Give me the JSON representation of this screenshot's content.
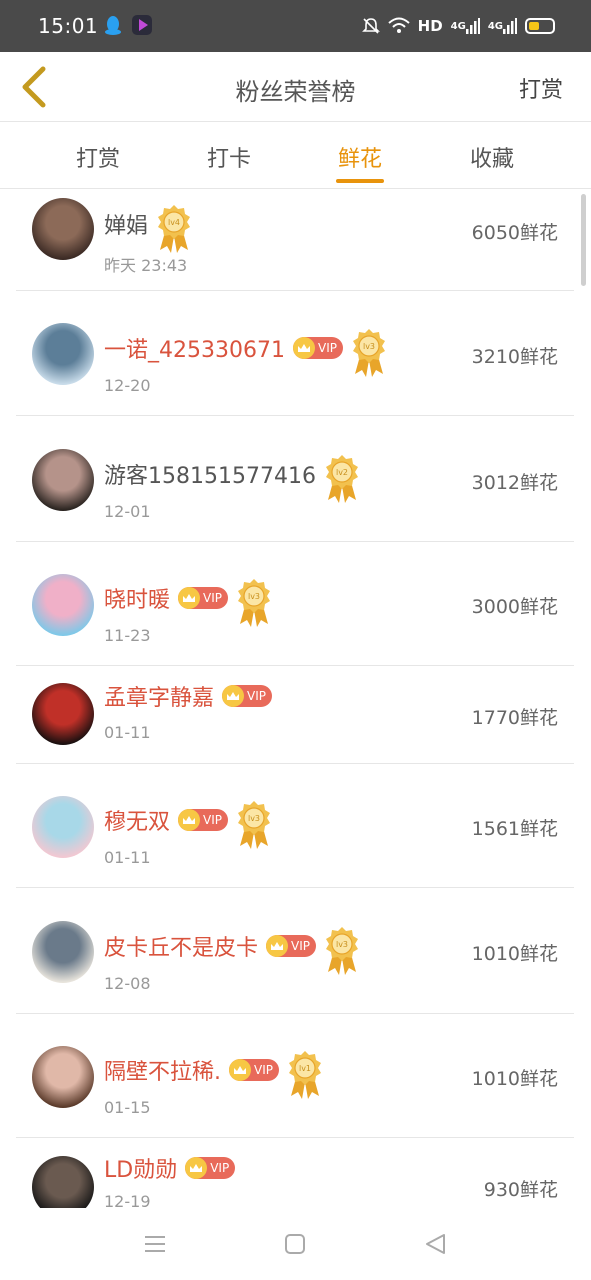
{
  "status_bar": {
    "time": "15:01",
    "network": "HD",
    "signal1": "4G",
    "signal2": "4G"
  },
  "header": {
    "title": "粉丝荣誉榜",
    "action_label": "打赏"
  },
  "tabs": [
    {
      "label": "打赏",
      "active": false
    },
    {
      "label": "打卡",
      "active": false
    },
    {
      "label": "鲜花",
      "active": true
    },
    {
      "label": "收藏",
      "active": false
    }
  ],
  "vip_text": "VIP",
  "rows": [
    {
      "name": "婵娟",
      "vip": false,
      "level": "lv4",
      "date": "昨天 23:43",
      "amount": "6050鲜花"
    },
    {
      "name": "一诺_425330671",
      "vip": true,
      "level": "lv3",
      "date": "12-20",
      "amount": "3210鲜花"
    },
    {
      "name": "游客158151577416",
      "vip": false,
      "level": "lv2",
      "date": "12-01",
      "amount": "3012鲜花"
    },
    {
      "name": "晓时暖",
      "vip": true,
      "level": "lv3",
      "date": "11-23",
      "amount": "3000鲜花"
    },
    {
      "name": "孟章字静嘉",
      "vip": true,
      "level": "",
      "date": "01-11",
      "amount": "1770鲜花"
    },
    {
      "name": "穆无双",
      "vip": true,
      "level": "lv3",
      "date": "01-11",
      "amount": "1561鲜花"
    },
    {
      "name": "皮卡丘不是皮卡",
      "vip": true,
      "level": "lv3",
      "date": "12-08",
      "amount": "1010鲜花"
    },
    {
      "name": "隔壁不拉稀.",
      "vip": true,
      "level": "lv1",
      "date": "01-15",
      "amount": "1010鲜花"
    },
    {
      "name": "LD勋勋",
      "vip": true,
      "level": "",
      "date": "12-19",
      "amount": "930鲜花"
    }
  ],
  "colors": {
    "accent": "#e8930c",
    "vip_name": "#d9533d",
    "vip_badge": "#e86a5a"
  }
}
